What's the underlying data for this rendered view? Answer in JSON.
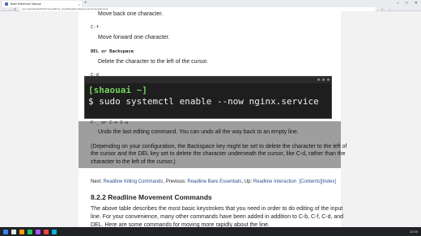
{
  "browser": {
    "tab_title": "Bash Reference Manual",
    "url": "gnu.org/software/bash/manual/html_node/Readline-Movement-Commands.html",
    "new_tab": "+",
    "win_min": "–",
    "win_max": "□",
    "win_close": "✕",
    "nav_back": "←",
    "nav_fwd": "→",
    "nav_reload": "↻"
  },
  "page": {
    "line_move_back": "Move back one character.",
    "key_cf": "C-f",
    "line_move_fwd": "Move forward one character.",
    "key_del": "DEL or Backspace",
    "line_delete_left": "Delete the character to the left of the cursor.",
    "key_cd": "C-d",
    "key_undo": "C-_ or C-x C-u",
    "line_undo": "Undo the last editing command. You can undo all the way back to an empty line.",
    "para1_l1": "(Depending on your configuration, the Backspace key might be set to delete the character to the left of",
    "para1_l2": "the cursor and the DEL key set to delete the character underneath the cursor, like C-d, rather than the",
    "para1_l3": "character to the left of the cursor.)",
    "nav_next_label": "Next: ",
    "nav_next_link": "Readline Killing Commands",
    "nav_prev_label": ", Previous: ",
    "nav_prev_link": "Readline Bare Essentials",
    "nav_up_label": ", Up: ",
    "nav_up_link": "Readline Interaction",
    "nav_contents": "[Contents]",
    "nav_index": "[Index]",
    "heading": "8.2.2 Readline Movement Commands",
    "para2_l1": "The above table describes the most basic keystrokes that you need in order to do editing of the input",
    "para2_l2": "line. For your convenience, many other commands have been added in addition to C-b, C-f, C-d, and",
    "para2_l3": "DEL. Here are some commands for moving more rapidly about the line."
  },
  "terminal": {
    "prompt_user": "[shaouai ~]",
    "command": "$ sudo systemctl enable --now nginx.service"
  },
  "taskbar": {
    "clock": "12:00"
  }
}
